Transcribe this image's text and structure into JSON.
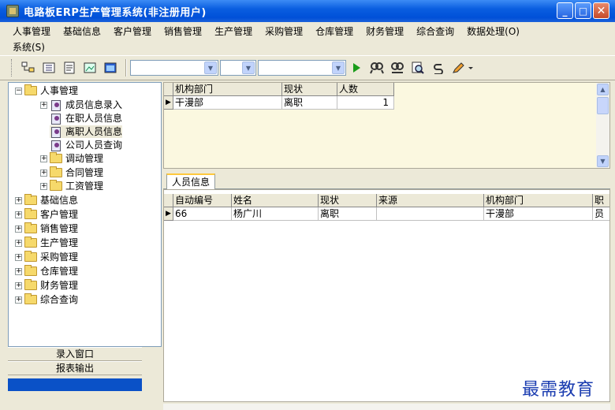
{
  "window": {
    "title": "电路板ERP生产管理系统(非注册用户)"
  },
  "menu": {
    "row1": [
      "人事管理",
      "基础信息",
      "客户管理",
      "销售管理",
      "生产管理",
      "采购管理",
      "仓库管理",
      "财务管理",
      "综合查询",
      "数据处理(O)"
    ],
    "row2": [
      "系统(S)"
    ]
  },
  "toolbar": {
    "icons": [
      "tree-icon",
      "list-icon",
      "doc-icon",
      "picture-icon",
      "window-icon",
      "play-icon",
      "find-icon",
      "find-next-icon",
      "preview-icon",
      "refresh-icon",
      "edit-icon"
    ]
  },
  "tree": {
    "hr": "人事管理",
    "hr_children": [
      "成员信息录入",
      "在职人员信息",
      "离职人员信息",
      "公司人员查询"
    ],
    "hr_sub": [
      "调动管理",
      "合同管理",
      "工资管理"
    ],
    "roots": [
      "基础信息",
      "客户管理",
      "销售管理",
      "生产管理",
      "采购管理",
      "仓库管理",
      "财务管理",
      "综合查询"
    ]
  },
  "nav": {
    "entry": "录入窗口",
    "report": "报表输出"
  },
  "grid1": {
    "headers": [
      "机构部门",
      "现状",
      "人数"
    ],
    "rows": [
      [
        "干漫部",
        "离职",
        "1"
      ]
    ]
  },
  "tab": {
    "label": "人员信息"
  },
  "grid2": {
    "headers": [
      "自动编号",
      "姓名",
      "现状",
      "来源",
      "机构部门",
      "职"
    ],
    "rows": [
      [
        "66",
        "杨广川",
        "离职",
        "",
        "干漫部",
        "员"
      ]
    ]
  },
  "watermark": "最需教育"
}
